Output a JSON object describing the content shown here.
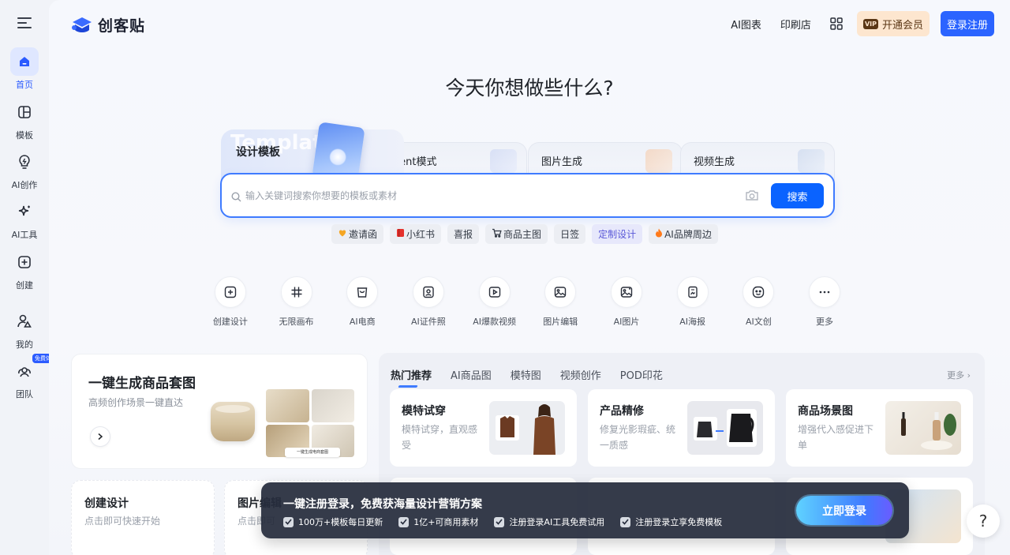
{
  "brand": {
    "name": "创客贴"
  },
  "sidebar": {
    "items": [
      {
        "label": "首页"
      },
      {
        "label": "模板"
      },
      {
        "label": "AI创作"
      },
      {
        "label": "AI工具"
      },
      {
        "label": "创建"
      },
      {
        "label": "我的"
      },
      {
        "label": "团队",
        "badge": "免费体验"
      }
    ]
  },
  "topnav": {
    "ai_chart": "AI图表",
    "print_shop": "印刷店",
    "vip_tag": "VIP",
    "vip_label": "开通会员",
    "login_label": "登录注册"
  },
  "headline": "今天你想做些什么?",
  "search": {
    "tabs": [
      {
        "label": "设计模板",
        "ghost": "Template"
      },
      {
        "label": "Agent模式"
      },
      {
        "label": "图片生成"
      },
      {
        "label": "视频生成"
      }
    ],
    "placeholder": "输入关键词搜索你想要的模板或素材",
    "button": "搜索",
    "tags": [
      {
        "label": "邀请函",
        "icon": "heart-icon"
      },
      {
        "label": "小红书",
        "icon": "book-icon"
      },
      {
        "label": "喜报"
      },
      {
        "label": "商品主图",
        "icon": "cart-icon"
      },
      {
        "label": "日签"
      },
      {
        "label": "定制设计"
      },
      {
        "label": "AI品牌周边",
        "icon": "fire-icon"
      }
    ]
  },
  "tools": [
    {
      "label": "创建设计",
      "icon": "plus-square-icon"
    },
    {
      "label": "无限画布",
      "icon": "hash-icon"
    },
    {
      "label": "AI电商",
      "icon": "shopping-bag-icon"
    },
    {
      "label": "AI证件照",
      "icon": "id-photo-icon"
    },
    {
      "label": "AI爆款视频",
      "icon": "video-icon"
    },
    {
      "label": "图片编辑",
      "icon": "image-edit-icon"
    },
    {
      "label": "AI图片",
      "icon": "ai-image-icon"
    },
    {
      "label": "AI海报",
      "icon": "poster-icon"
    },
    {
      "label": "AI文创",
      "icon": "smile-icon"
    },
    {
      "label": "更多",
      "icon": "more-icon"
    }
  ],
  "feature": {
    "title": "一键生成商品套图",
    "subtitle": "高频创作场景一键直达",
    "caption": "一键生成电商套图"
  },
  "small_cards": [
    {
      "title": "创建设计",
      "subtitle": "点击即可快速开始"
    },
    {
      "title": "图片编辑",
      "subtitle": "点击即可"
    }
  ],
  "hot": {
    "tabs": [
      "热门推荐",
      "AI商品图",
      "模特图",
      "视频创作",
      "POD印花"
    ],
    "more": "更多",
    "cards": [
      {
        "title": "模特试穿",
        "desc": "模特试穿，直观感受"
      },
      {
        "title": "产品精修",
        "desc": "修复光影瑕疵、统一质感"
      },
      {
        "title": "商品场景图",
        "desc": "增强代入感促进下单"
      }
    ]
  },
  "login_bar": {
    "title": "一键注册登录，免费获海量设计营销方案",
    "perks": [
      "100万+模板每日更新",
      "1亿+可商用素材",
      "注册登录AI工具免费试用",
      "注册登录立享免费模板"
    ],
    "cta": "立即登录"
  },
  "help": "?",
  "colors": {
    "accent": "#2b64ff",
    "vip_bg": "#fde6cf",
    "bar_bg": "#262c3c"
  }
}
